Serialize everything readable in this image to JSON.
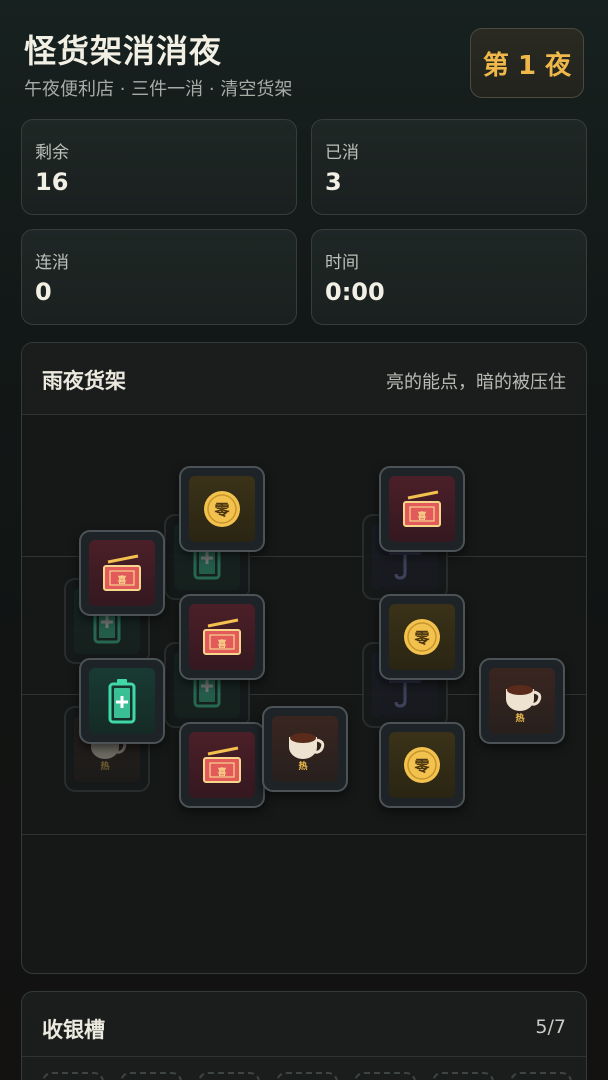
{
  "header": {
    "title": "怪货架消消夜",
    "subtitle": "午夜便利店 · 三件一消 · 清空货架",
    "night_label": "第 1 夜"
  },
  "stats": [
    {
      "label": "剩余",
      "value": "16"
    },
    {
      "label": "已消",
      "value": "3"
    },
    {
      "label": "连消",
      "value": "0"
    },
    {
      "label": "时间",
      "value": "0:00"
    }
  ],
  "shelf": {
    "title": "雨夜货架",
    "hint": "亮的能点，暗的被压住"
  },
  "tiles": [
    {
      "type": "battery-icon",
      "state": "covered"
    },
    {
      "type": "battery-icon",
      "state": "covered"
    },
    {
      "type": "battery-icon",
      "state": "covered"
    },
    {
      "type": "coffee-cup-icon",
      "state": "covered",
      "glyph": "热"
    },
    {
      "type": "umbrella-icon",
      "state": "covered"
    },
    {
      "type": "umbrella-icon",
      "state": "covered"
    },
    {
      "type": "coin-icon",
      "state": "active",
      "glyph": "零"
    },
    {
      "type": "red-envelope-icon",
      "state": "active",
      "glyph": "喜"
    },
    {
      "type": "red-envelope-icon",
      "state": "active",
      "glyph": "喜"
    },
    {
      "type": "battery-icon",
      "state": "active"
    },
    {
      "type": "red-envelope-icon",
      "state": "active",
      "glyph": "喜"
    },
    {
      "type": "coffee-cup-icon",
      "state": "active",
      "glyph": "热"
    },
    {
      "type": "red-envelope-icon",
      "state": "active",
      "glyph": "喜"
    },
    {
      "type": "coin-icon",
      "state": "active",
      "glyph": "零"
    },
    {
      "type": "coffee-cup-icon",
      "state": "active",
      "glyph": "热"
    },
    {
      "type": "coin-icon",
      "state": "active",
      "glyph": "零"
    }
  ],
  "cashier": {
    "title": "收银槽",
    "count": "5/7",
    "slots": 7
  },
  "colors": {
    "accent": "#f0b84a",
    "coin": "#f2c14e",
    "envelope": "#e25a5a",
    "battery": "#3fd8a6"
  }
}
